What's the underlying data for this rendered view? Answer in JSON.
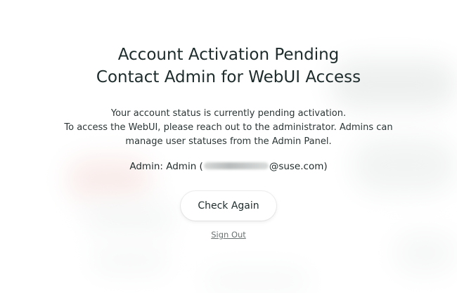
{
  "heading": {
    "line1": "Account Activation Pending",
    "line2": "Contact Admin for WebUI Access"
  },
  "message": {
    "line1": "Your account status is currently pending activation.",
    "line2": "To access the WebUI, please reach out to the administrator. Admins can",
    "line3": "manage user statuses from the Admin Panel."
  },
  "admin": {
    "prefix": "Admin: Admin (",
    "email_suffix": "@suse.com)"
  },
  "actions": {
    "check_again_label": "Check Again",
    "sign_out_label": "Sign Out"
  }
}
